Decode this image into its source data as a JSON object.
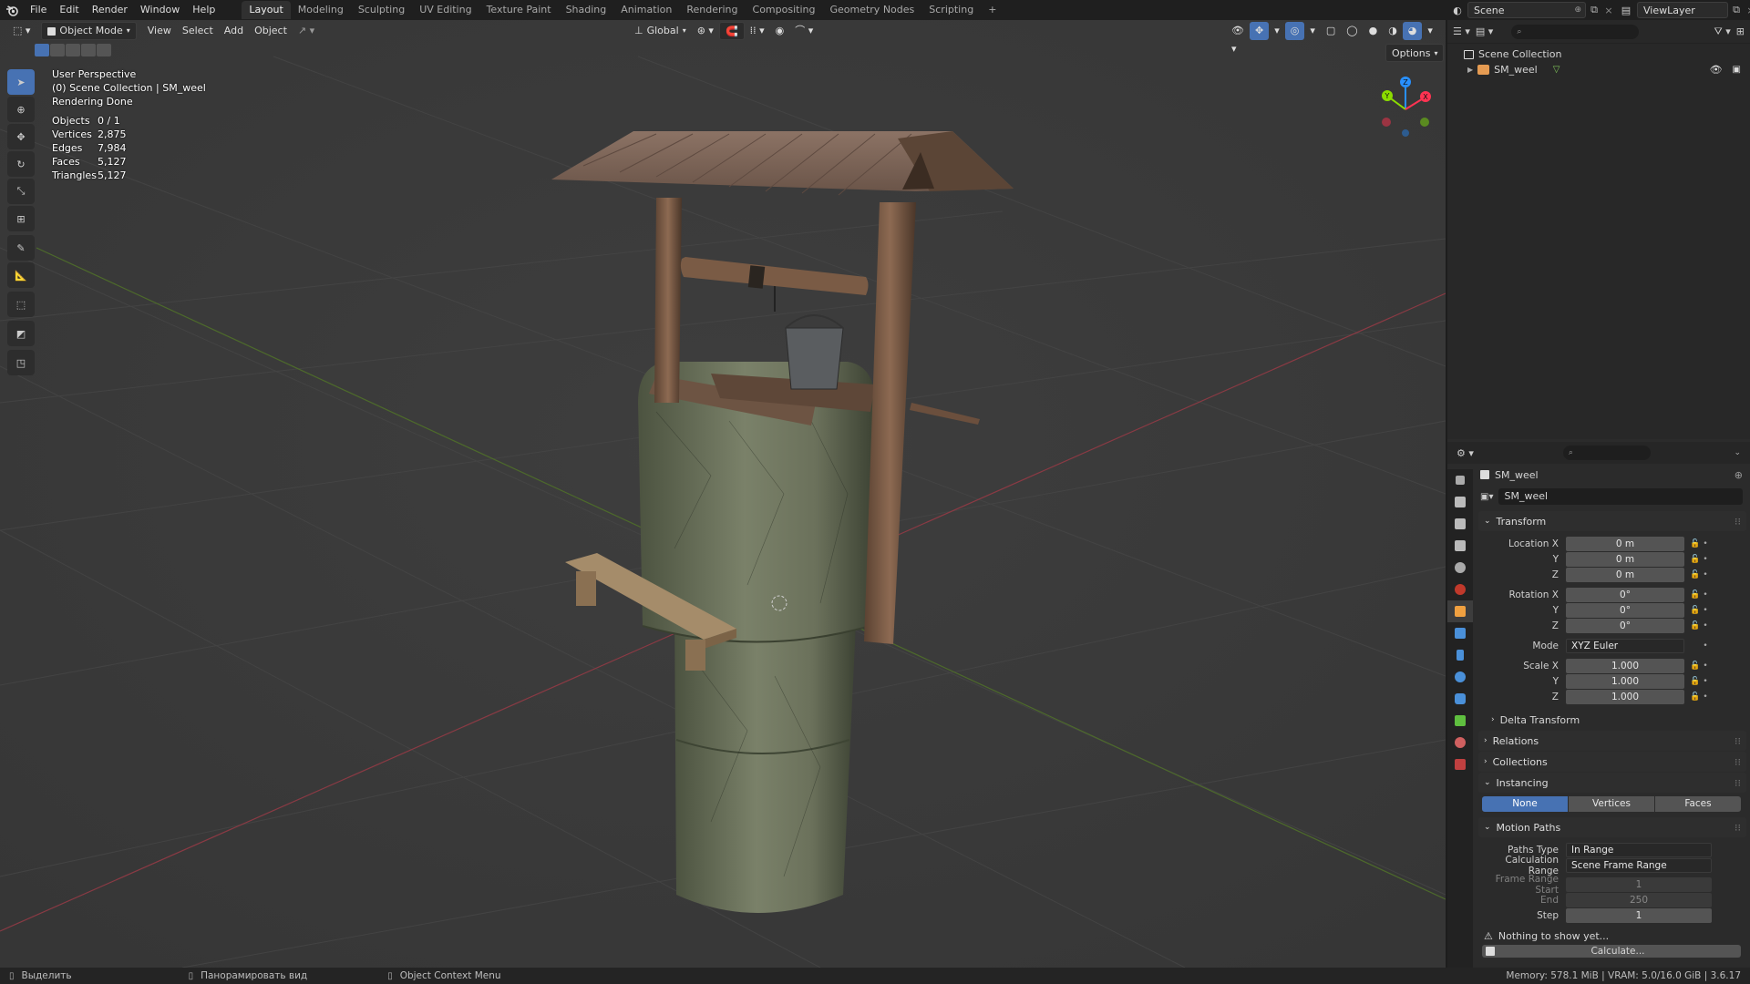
{
  "topbar": {
    "menus": [
      "File",
      "Edit",
      "Render",
      "Window",
      "Help"
    ],
    "workspaces": [
      "Layout",
      "Modeling",
      "Sculpting",
      "UV Editing",
      "Texture Paint",
      "Shading",
      "Animation",
      "Rendering",
      "Compositing",
      "Geometry Nodes",
      "Scripting"
    ],
    "active_workspace": "Layout",
    "add_tab_label": "+",
    "scene_label": "Scene",
    "viewlayer_label": "ViewLayer"
  },
  "viewport_header": {
    "mode_label": "Object Mode",
    "menus": [
      "View",
      "Select",
      "Add",
      "Object"
    ],
    "orientation_label": "Global",
    "options_label": "Options"
  },
  "overlay": {
    "perspective": "User Perspective",
    "collection_path": "(0) Scene Collection | SM_weel",
    "render_status": "Rendering Done",
    "stats": [
      {
        "key": "Objects",
        "value": "0 / 1"
      },
      {
        "key": "Vertices",
        "value": "2,875"
      },
      {
        "key": "Edges",
        "value": "7,984"
      },
      {
        "key": "Faces",
        "value": "5,127"
      },
      {
        "key": "Triangles",
        "value": "5,127"
      }
    ]
  },
  "gizmo": {
    "x_label": "X",
    "y_label": "Y",
    "z_label": "Z"
  },
  "outliner": {
    "root": "Scene Collection",
    "object": "SM_weel"
  },
  "properties": {
    "object_name": "SM_weel",
    "data_name": "SM_weel",
    "transform": {
      "title": "Transform",
      "location_label": "Location X",
      "location": [
        "0 m",
        "0 m",
        "0 m"
      ],
      "rotation_label": "Rotation X",
      "rotation": [
        "0°",
        "0°",
        "0°"
      ],
      "y_label": "Y",
      "z_label": "Z",
      "mode_label": "Mode",
      "mode_value": "XYZ Euler",
      "scale_label": "Scale X",
      "scale": [
        "1.000",
        "1.000",
        "1.000"
      ]
    },
    "delta_transform": "Delta Transform",
    "relations": "Relations",
    "collections": "Collections",
    "instancing": {
      "title": "Instancing",
      "options": [
        "None",
        "Vertices",
        "Faces"
      ],
      "active": "None"
    },
    "motion_paths": {
      "title": "Motion Paths",
      "paths_type_label": "Paths Type",
      "paths_type_value": "In Range",
      "calc_range_label": "Calculation Range",
      "calc_range_value": "Scene Frame Range",
      "frame_start_label": "Frame Range Start",
      "frame_start_value": "1",
      "end_label": "End",
      "end_value": "250",
      "step_label": "Step",
      "step_value": "1",
      "warning": "Nothing to show yet...",
      "calculate_label": "Calculate..."
    }
  },
  "statusbar": {
    "select": "Выделить",
    "pan": "Панорамировать вид",
    "context": "Object Context Menu",
    "stats": "Memory: 578.1 MiB | VRAM: 5.0/16.0 GiB | 3.6.17"
  },
  "colors": {
    "accent": "#4772b3",
    "axis_x": "#ff3352",
    "axis_y": "#8bdc00",
    "axis_z": "#2890ff"
  }
}
